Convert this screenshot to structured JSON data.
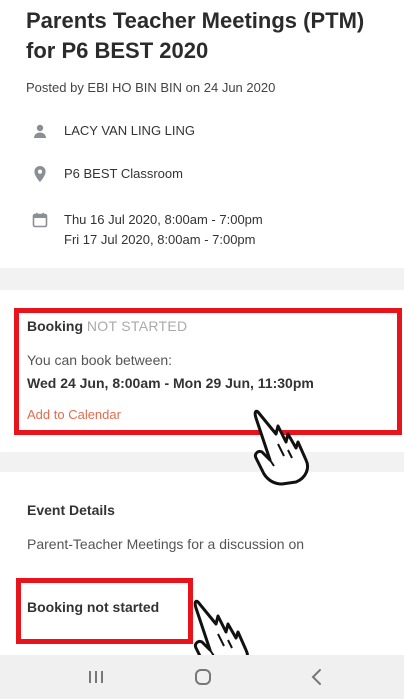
{
  "post": {
    "title": "Parents Teacher Meetings (PTM) for P6 BEST 2020",
    "posted_by": "Posted by EBI HO BIN BIN on 24 Jun 2020",
    "person": "LACY VAN LING LING",
    "location": "P6 BEST Classroom",
    "date_line_1": "Thu 16 Jul 2020, 8:00am - 7:00pm",
    "date_line_2": "Fri 17 Jul 2020, 8:00am - 7:00pm"
  },
  "booking": {
    "label": "Booking",
    "status": "NOT STARTED",
    "between_text": "You can book between:",
    "range": "Wed 24 Jun, 8:00am - Mon 29 Jun, 11:30pm",
    "add_to_calendar": "Add to Calendar"
  },
  "event": {
    "heading": "Event Details",
    "description": "Parent-Teacher Meetings for a discussion on"
  },
  "footer": {
    "booking_not_started": "Booking not started"
  },
  "icons": {
    "person": "person-icon",
    "location": "location-pin-icon",
    "calendar": "calendar-icon",
    "recent": "recent-apps-icon",
    "home": "home-icon",
    "back": "back-icon"
  },
  "colors": {
    "highlight": "#e8141c",
    "link": "#e56a4f",
    "status_muted": "#aaaaaa",
    "icon_grey": "#8a8f96"
  }
}
